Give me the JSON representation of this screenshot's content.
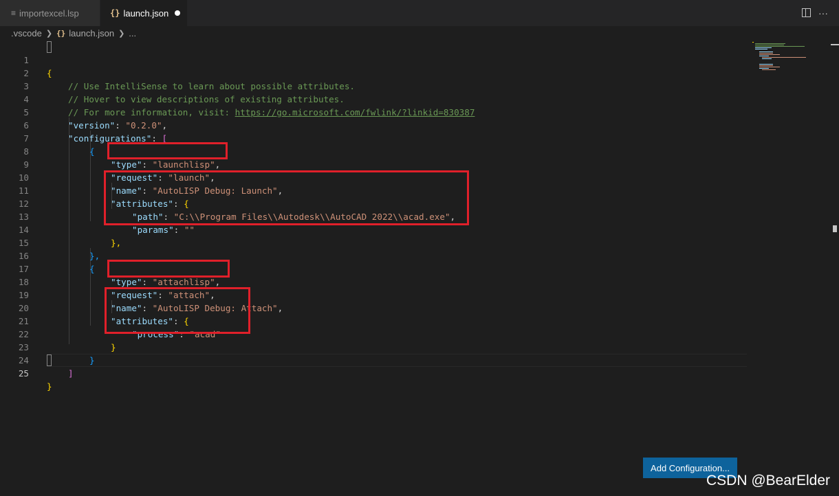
{
  "tabs": [
    {
      "label": "importexcel.lsp",
      "icon": "lines-icon",
      "active": false
    },
    {
      "label": "launch.json",
      "icon": "braces-icon",
      "active": true,
      "dirty": true
    }
  ],
  "toolbar": {
    "split_icon": "split-editor-icon",
    "more_icon": "more-actions-icon",
    "more_glyph": "···"
  },
  "breadcrumb": [
    ".vscode",
    "launch.json",
    "..."
  ],
  "braces_glyph": "{}",
  "editor": {
    "current_line": 25,
    "lines": [
      {
        "n": "1"
      },
      {
        "n": "2"
      },
      {
        "n": "3"
      },
      {
        "n": "4"
      },
      {
        "n": "5"
      },
      {
        "n": "6"
      },
      {
        "n": "7"
      },
      {
        "n": "8"
      },
      {
        "n": "9"
      },
      {
        "n": "10"
      },
      {
        "n": "11"
      },
      {
        "n": "12"
      },
      {
        "n": "13"
      },
      {
        "n": "14"
      },
      {
        "n": "15"
      },
      {
        "n": "16"
      },
      {
        "n": "17"
      },
      {
        "n": "18"
      },
      {
        "n": "19"
      },
      {
        "n": "20"
      },
      {
        "n": "21"
      },
      {
        "n": "22"
      },
      {
        "n": "23"
      },
      {
        "n": "24"
      },
      {
        "n": "25"
      }
    ],
    "code": {
      "l1": "{",
      "l2": "// Use IntelliSense to learn about possible attributes.",
      "l3": "// Hover to view descriptions of existing attributes.",
      "l4_comment": "// For more information, visit: ",
      "l4_url": "https://go.microsoft.com/fwlink/?linkid=830387",
      "version_key": "\"version\"",
      "version_val": "\"0.2.0\"",
      "configurations_key": "\"configurations\"",
      "open_square": "[",
      "open_brace": "{",
      "type_key": "\"type\"",
      "type1_val": "\"launchlisp\"",
      "request_key": "\"request\"",
      "request1_val": "\"launch\"",
      "name_key": "\"name\"",
      "name1_val": "\"AutoLISP Debug: Launch\"",
      "attributes_key": "\"attributes\"",
      "path_key": "\"path\"",
      "path_val": "\"C:\\\\Program Files\\\\Autodesk\\\\AutoCAD 2022\\\\acad.exe\"",
      "params_key": "\"params\"",
      "params_val": "\"\"",
      "close_attr1": "},",
      "close_cfg1": "},",
      "type2_val": "\"attachlisp\"",
      "request2_val": "\"attach\"",
      "name2_val": "\"AutoLISP Debug: Attach\"",
      "process_key": "\"process\"",
      "process_val": "\"acad\"",
      "close_attr2": "}",
      "close_cfg2": "}",
      "close_square": "]",
      "close_root": "}"
    }
  },
  "add_configuration_button": "Add Configuration...",
  "watermark": "CSDN @BearElder",
  "colors": {
    "editor_bg": "#1e1e1e",
    "key": "#9cdcfe",
    "string": "#ce9178",
    "comment": "#6a9955",
    "bracket_gold": "#ffd700",
    "bracket_purple": "#da70d6",
    "bracket_blue": "#179fff",
    "highlight_box": "#e0202a",
    "button_bg": "#0e639c"
  }
}
